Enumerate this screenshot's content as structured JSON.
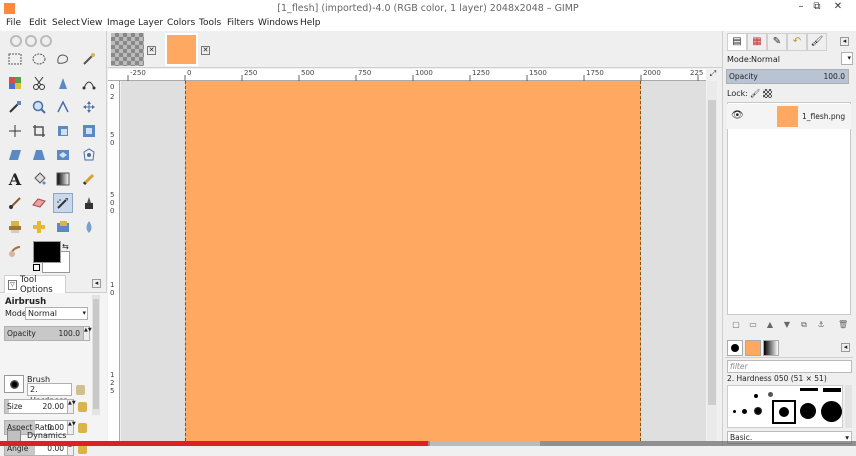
{
  "window": {
    "title": "[1_flesh] (imported)-4.0 (RGB color, 1 layer) 2048x2048 – GIMP",
    "minimize": "–",
    "maximize": "⧉",
    "close": "✕"
  },
  "menu": [
    "File",
    "Edit",
    "Select",
    "View",
    "Image",
    "Layer",
    "Colors",
    "Tools",
    "Filters",
    "Windows",
    "Help"
  ],
  "tool_options": {
    "tab_label": "Tool Options",
    "tool_name": "Airbrush",
    "mode_label": "Mode:",
    "mode_value": "Normal",
    "opacity_label": "Opacity",
    "opacity_value": "100.0",
    "brush_label": "Brush",
    "brush_value": "2. Hardness 05",
    "size_label": "Size",
    "size_value": "20.00",
    "aspect_label": "Aspect Ratio",
    "aspect_value": "0.00",
    "angle_label": "Angle",
    "angle_value": "0.00",
    "dynamics_label": "Dynamics"
  },
  "rulers": {
    "top": [
      "-250",
      "0",
      "250",
      "500",
      "750",
      "1000",
      "1250",
      "1500",
      "1750",
      "2000",
      "225"
    ],
    "left": [
      "0",
      "2",
      "5",
      "0",
      "5",
      "0",
      "0",
      "1",
      "0",
      "1",
      "2",
      "5"
    ]
  },
  "layers": {
    "mode_label": "Mode:",
    "mode_value": "Normal",
    "opacity_label": "Opacity",
    "opacity_value": "100.0",
    "lock_label": "Lock:",
    "layer_name": "1_flesh.png"
  },
  "brushes": {
    "filter_placeholder": "filter",
    "current_brush": "2. Hardness 050 (51 × 51)",
    "preset": "Basic."
  },
  "colors": {
    "canvas_fill": "#ffa862",
    "foreground": "#000000",
    "background": "#ffffff"
  },
  "video": {
    "progress": 0.5
  }
}
